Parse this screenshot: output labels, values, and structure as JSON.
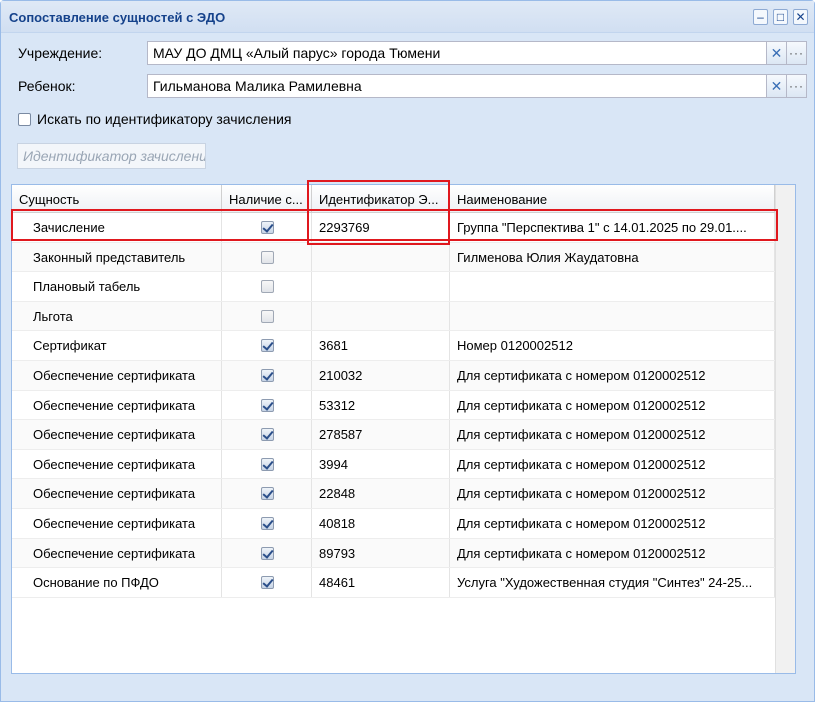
{
  "window": {
    "title": "Сопоставление сущностей с ЭДО",
    "tools": [
      "–",
      "□",
      "✕"
    ]
  },
  "form": {
    "institution_label": "Учреждение:",
    "institution_value": "МАУ ДО ДМЦ «Алый парус» города Тюмени",
    "child_label": "Ребенок:",
    "child_value": "Гильманова Малика Рамилевна",
    "clear_glyph": "✕",
    "lookup_glyph": "···",
    "search_by_id_label": "Искать по идентификатору зачисления",
    "search_by_id_checked": false,
    "enrollment_id_placeholder": "Идентификатор зачислени"
  },
  "grid": {
    "columns": [
      "Сущность",
      "Наличие с...",
      "Идентификатор Э...",
      "Наименование"
    ],
    "rows": [
      {
        "entity": "Зачисление",
        "present": true,
        "id": "2293769",
        "name": "Группа \"Перспектива 1\" с 14.01.2025 по 29.01...."
      },
      {
        "entity": "Законный представитель",
        "present": false,
        "id": "",
        "name": "Гилменова Юлия Жаудатовна"
      },
      {
        "entity": "Плановый табель",
        "present": false,
        "id": "",
        "name": ""
      },
      {
        "entity": "Льгота",
        "present": false,
        "id": "",
        "name": ""
      },
      {
        "entity": "Сертификат",
        "present": true,
        "id": "3681",
        "name": "Номер 0120002512"
      },
      {
        "entity": "Обеспечение сертификата",
        "present": true,
        "id": "210032",
        "name": "Для сертификата с номером 0120002512"
      },
      {
        "entity": "Обеспечение сертификата",
        "present": true,
        "id": "53312",
        "name": "Для сертификата с номером 0120002512"
      },
      {
        "entity": "Обеспечение сертификата",
        "present": true,
        "id": "278587",
        "name": "Для сертификата с номером 0120002512"
      },
      {
        "entity": "Обеспечение сертификата",
        "present": true,
        "id": "3994",
        "name": "Для сертификата с номером 0120002512"
      },
      {
        "entity": "Обеспечение сертификата",
        "present": true,
        "id": "22848",
        "name": "Для сертификата с номером 0120002512"
      },
      {
        "entity": "Обеспечение сертификата",
        "present": true,
        "id": "40818",
        "name": "Для сертификата с номером 0120002512"
      },
      {
        "entity": "Обеспечение сертификата",
        "present": true,
        "id": "89793",
        "name": "Для сертификата с номером 0120002512"
      },
      {
        "entity": "Основание по ПФДО",
        "present": true,
        "id": "48461",
        "name": "Услуга \"Художественная студия \"Синтез\" 24-25..."
      }
    ]
  },
  "colors": {
    "window_bg": "#d9e6f6",
    "title_text": "#15428b",
    "highlight_frame": "#e0181e"
  }
}
